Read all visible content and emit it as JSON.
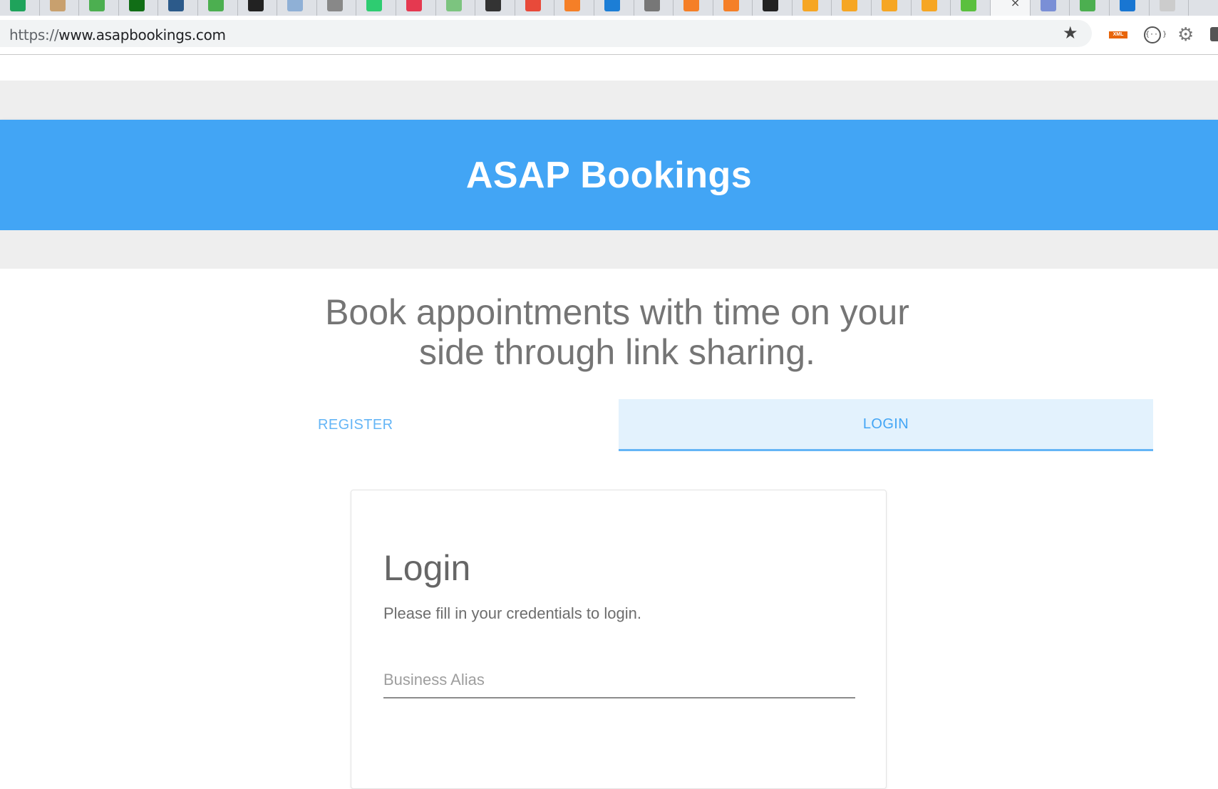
{
  "browser": {
    "url_scheme": "https://",
    "url_host": "www.asapbookings.com",
    "tab_count": 30,
    "tab_favicon_colors": [
      "#1fa35b",
      "#c8a06e",
      "#4caf50",
      "#116e16",
      "#2c5a8a",
      "#4caf50",
      "#222222",
      "#8fb0d6",
      "#888888",
      "#2ecc71",
      "#e53950",
      "#7cc47f",
      "#333333",
      "#e84a3a",
      "#f57f27",
      "#1c7ed6",
      "#777777",
      "#f57f27",
      "#f57f27",
      "#222222",
      "#f6a623",
      "#f6a623",
      "#f6a623",
      "#f6a623",
      "#5ac03e",
      "#ffffff",
      "#7a8fd6",
      "#4caf50",
      "#1976d2",
      "#cccccc"
    ],
    "star_icon": "★",
    "extensions": {
      "xml_label": "XML",
      "braces_label": "{···}",
      "gear_glyph": "⚙"
    }
  },
  "header": {
    "title": "ASAP Bookings"
  },
  "tagline": {
    "line1": "Book appointments with time on your",
    "line2": "side through link sharing."
  },
  "tabs": {
    "register_label": "REGISTER",
    "login_label": "LOGIN",
    "active": "LOGIN"
  },
  "login_card": {
    "title": "Login",
    "subtitle": "Please fill in your credentials to login.",
    "business_alias_placeholder": "Business Alias",
    "business_alias_value": ""
  },
  "colors": {
    "primary": "#42a5f5",
    "tab_active_bg": "#e3f2fd",
    "tab_text": "#64b5f6",
    "band_grey": "#eeeeee",
    "text_grey": "#757575"
  }
}
